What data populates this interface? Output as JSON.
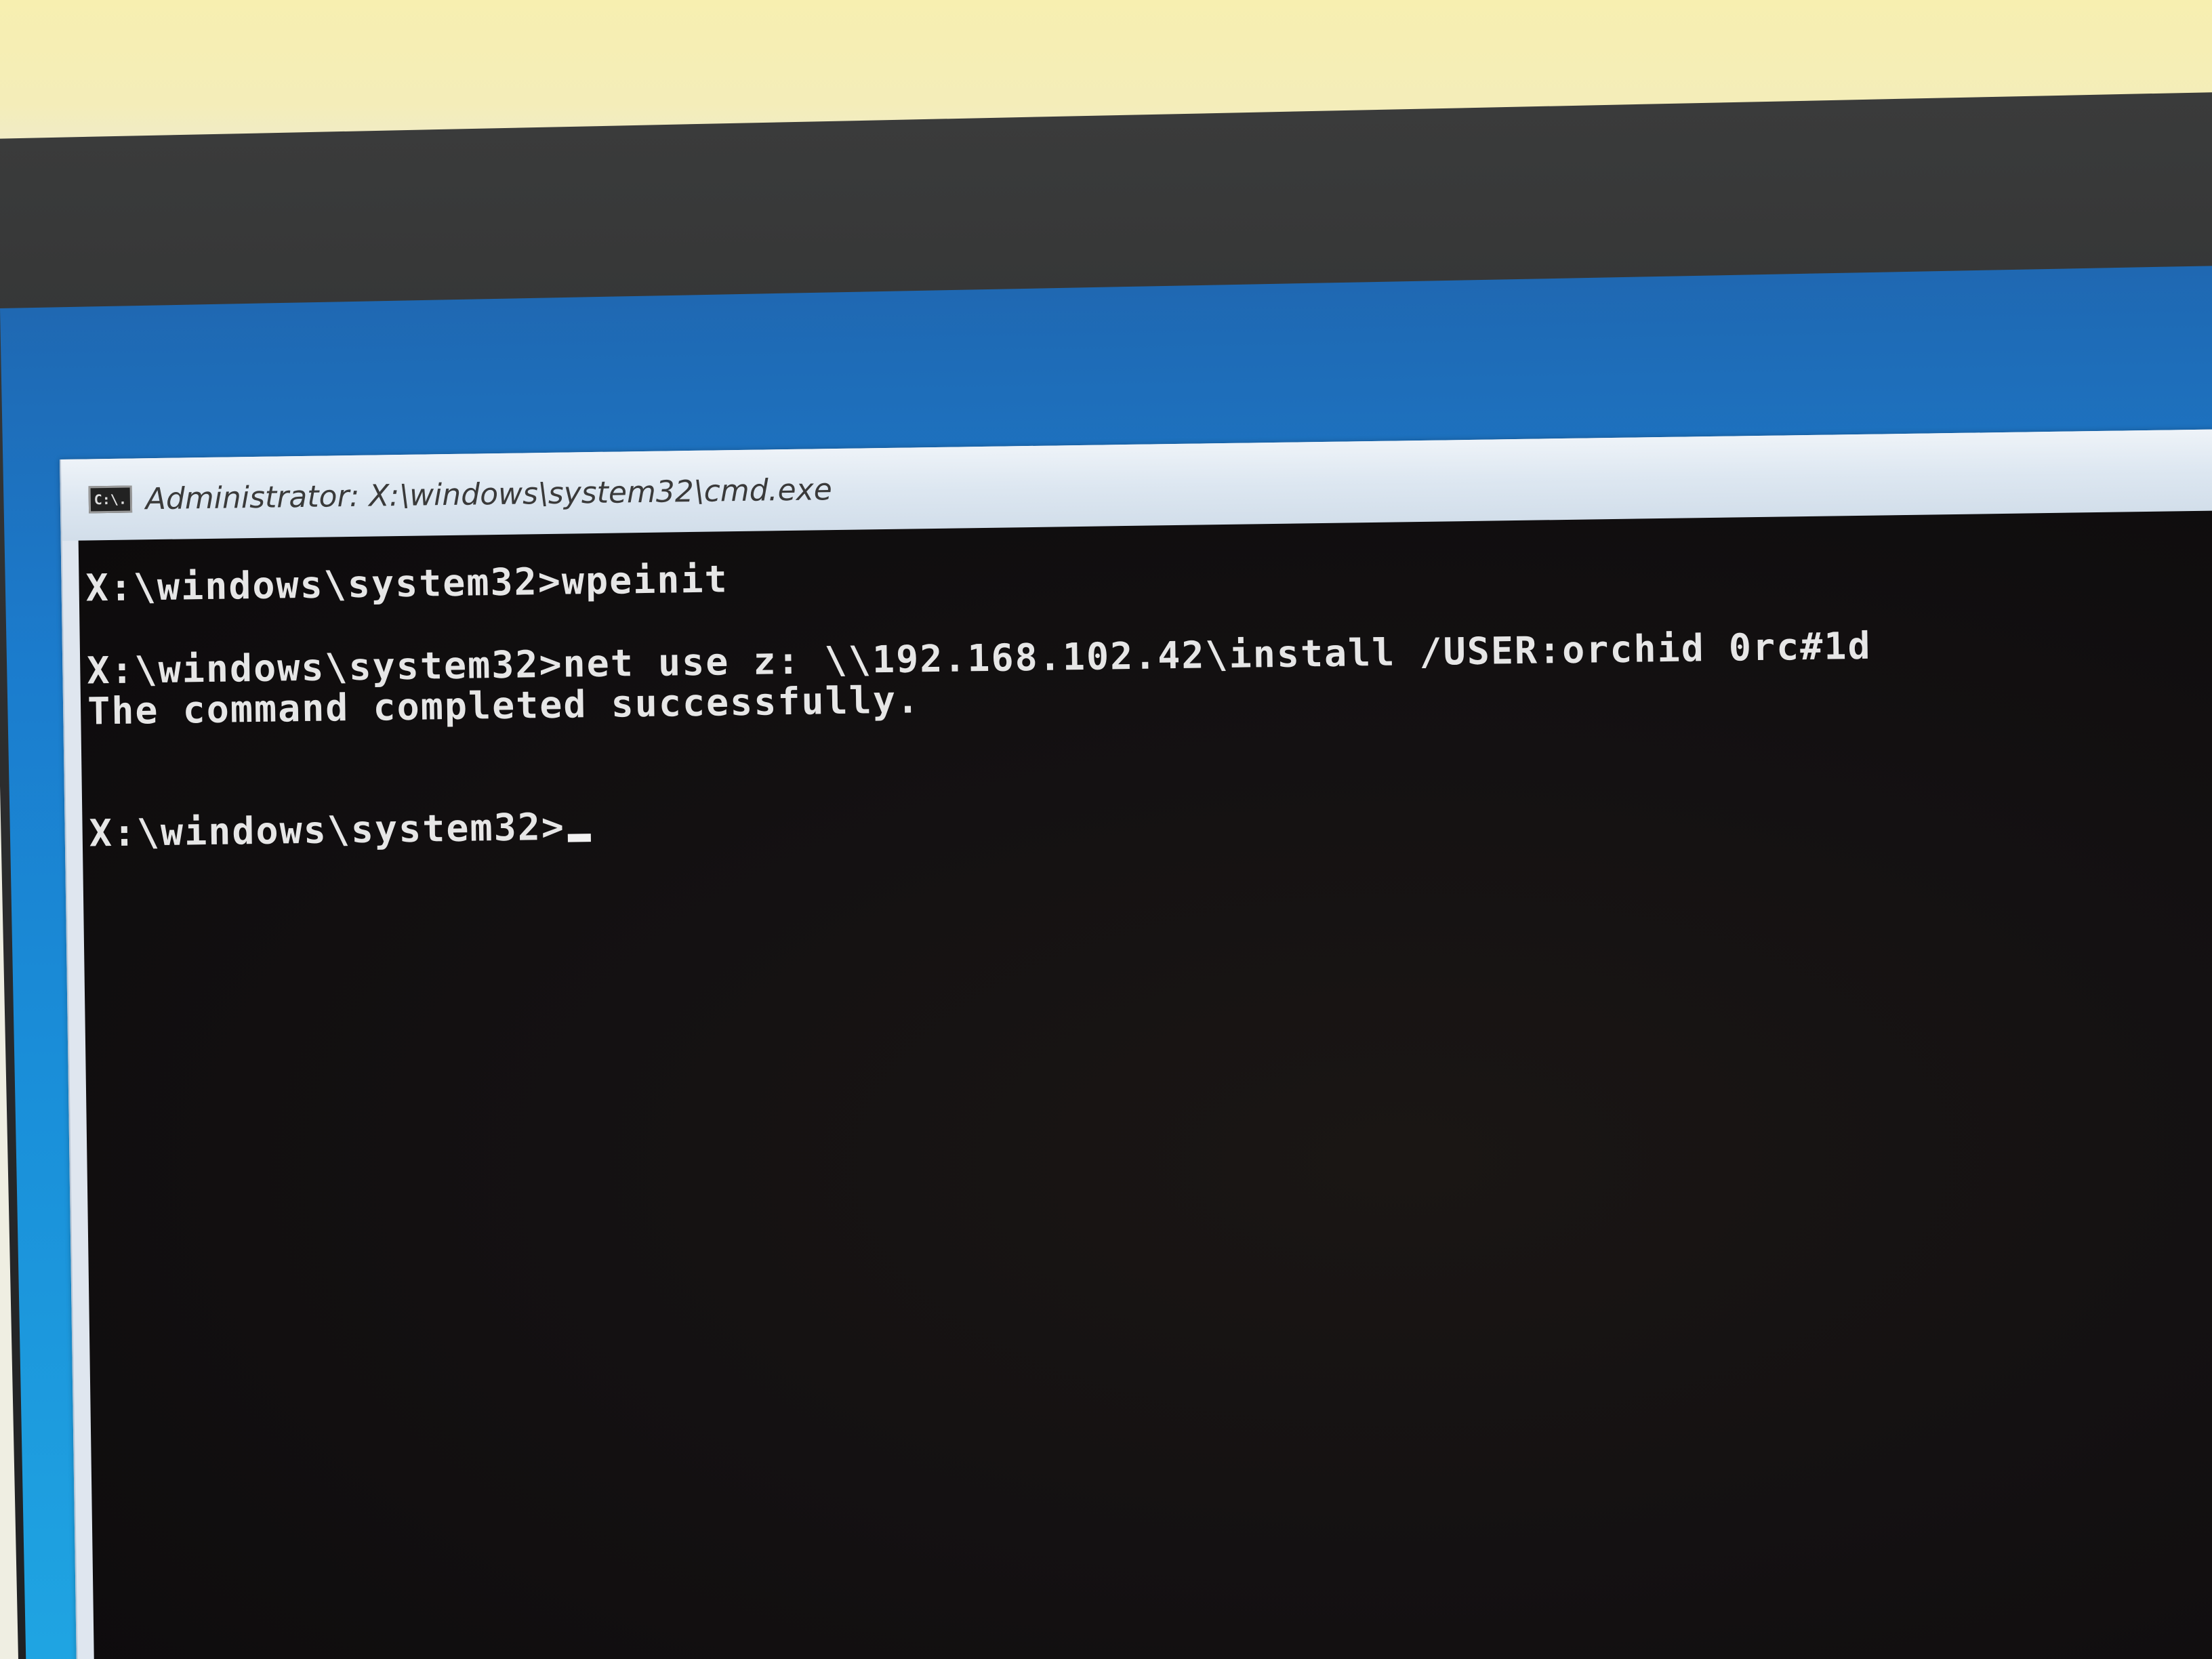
{
  "window": {
    "title": "Administrator: X:\\windows\\system32\\cmd.exe",
    "icon_text": "C:\\."
  },
  "console": {
    "lines": [
      "X:\\windows\\system32>wpeinit",
      "X:\\windows\\system32>net use z: \\\\192.168.102.42\\install /USER:orchid 0rc#1d",
      "The command completed successfully.",
      "X:\\windows\\system32>"
    ]
  },
  "colors": {
    "console_bg": "#141112",
    "console_text": "#e6e6e6",
    "desktop_blue": "#1a8fd9"
  }
}
